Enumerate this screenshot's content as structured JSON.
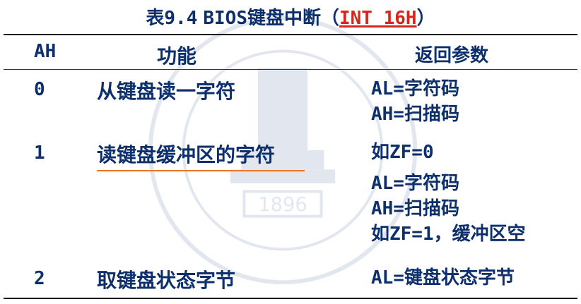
{
  "title": {
    "prefix": "表9.4",
    "main": "BIOS键盘中断（",
    "link": "INT 16H",
    "suffix": "）"
  },
  "headers": {
    "ah": "AH",
    "function": "功能",
    "returns": "返回参数"
  },
  "rows": [
    {
      "ah": "0",
      "function": "从键盘读一字符",
      "returns": [
        "AL=字符码",
        "AH=扫描码"
      ]
    },
    {
      "ah": "1",
      "function": "读键盘缓冲区的字符",
      "returns": [
        "如ZF=0",
        "AL=字符码",
        "AH=扫描码",
        "如ZF=1，缓冲区空"
      ]
    },
    {
      "ah": "2",
      "function": "取键盘状态字节",
      "returns": [
        "AL=键盘状态字节"
      ]
    }
  ],
  "watermark": {
    "year": "1896"
  }
}
